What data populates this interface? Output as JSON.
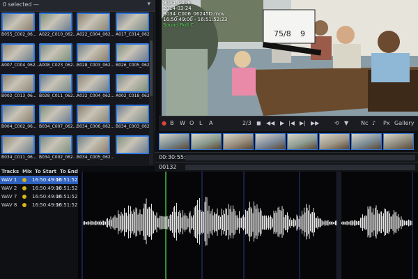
{
  "browser": {
    "selection_label": "0 selected —",
    "thumbnails": [
      {
        "label": "B055_C002_06..."
      },
      {
        "label": "A022_C010_062..."
      },
      {
        "label": "A022_C004_062..."
      },
      {
        "label": "A017_C014_062..."
      },
      {
        "label": "A007_C004_062..."
      },
      {
        "label": "A008_C023_062..."
      },
      {
        "label": "B028_C003_062..."
      },
      {
        "label": "B026_C005_062..."
      },
      {
        "label": "B002_C013_06..."
      },
      {
        "label": "B028_C011_062..."
      },
      {
        "label": "A032_C004_062..."
      },
      {
        "label": "A002_C018_062..."
      },
      {
        "label": "B004_C002_06..."
      },
      {
        "label": "B034_C007_062..."
      },
      {
        "label": "B034_C006_062..."
      },
      {
        "label": "B034_C003_062..."
      },
      {
        "label": "B034_C011_06..."
      },
      {
        "label": "B034_C002_062..."
      },
      {
        "label": "B034_C005_062..."
      },
      {
        "label": ""
      }
    ]
  },
  "viewer": {
    "meta_lines": [
      "9034_C006",
      "2014-03-24",
      "B034_C006_06245D.mov",
      "16:50:49:00 - 16:51:52:23",
      "Sound Roll C"
    ],
    "clap_numbers": [
      "75/8",
      "9"
    ]
  },
  "viewer_controls": {
    "icons": [
      "B",
      "W",
      "O",
      "L",
      "A"
    ],
    "counter": "2/3",
    "nc_label": "Nc",
    "px_label": "Px",
    "gallery_label": "Gallery"
  },
  "timeline": {
    "timecode": "00:30:55:12",
    "frame_count": "00132"
  },
  "tracks": {
    "headers": {
      "tracks": "Tracks",
      "mix": "Mix",
      "to_start": "To Start",
      "to_end": "To End"
    },
    "rows": [
      {
        "name": "WAV 1",
        "start": "16:50:49:00",
        "end": "16:51:52:23",
        "selected": true
      },
      {
        "name": "WAV 2",
        "start": "16:50:49:00",
        "end": "16:51:52:23",
        "selected": false
      },
      {
        "name": "WAV 7",
        "start": "16:50:49:00",
        "end": "16:51:52:23",
        "selected": false
      },
      {
        "name": "WAV 8",
        "start": "16:50:49:00",
        "end": "16:51:52:23",
        "selected": false
      }
    ]
  },
  "colors": {
    "accent": "#2f77e0",
    "waveform": "#e6e6e6",
    "playhead": "#3fbf3f",
    "selected_row": "#2d5fbd"
  }
}
